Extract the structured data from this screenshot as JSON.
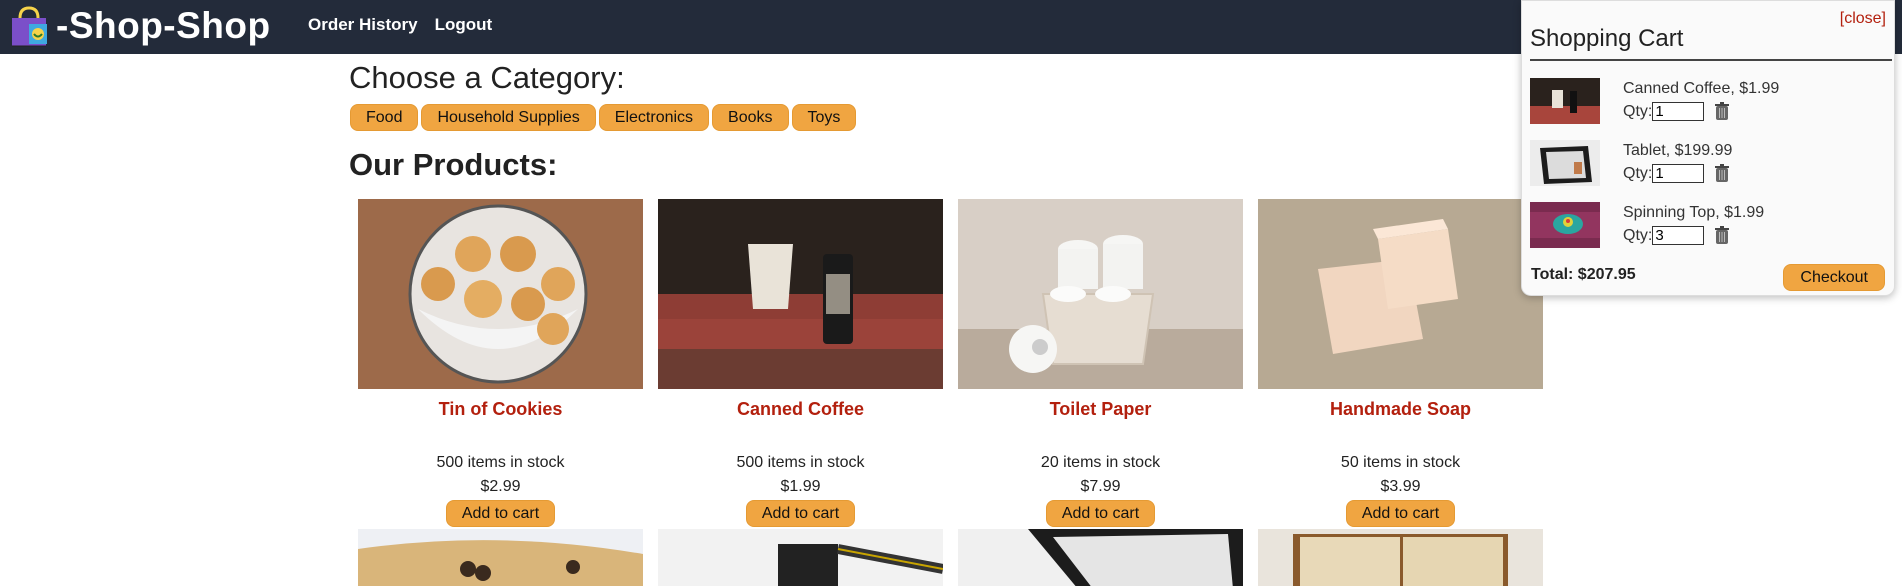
{
  "header": {
    "brand": "-Shop-Shop",
    "nav": [
      "Order History",
      "Logout"
    ]
  },
  "categories": {
    "title": "Choose a Category:",
    "items": [
      "Food",
      "Household Supplies",
      "Electronics",
      "Books",
      "Toys"
    ]
  },
  "products": {
    "title": "Our Products:",
    "items": [
      {
        "name": "Tin of Cookies",
        "stock": "500 items in stock",
        "price": "$2.99",
        "button": "Add to cart"
      },
      {
        "name": "Canned Coffee",
        "stock": "500 items in stock",
        "price": "$1.99",
        "button": "Add to cart"
      },
      {
        "name": "Toilet Paper",
        "stock": "20 items in stock",
        "price": "$7.99",
        "button": "Add to cart"
      },
      {
        "name": "Handmade Soap",
        "stock": "50 items in stock",
        "price": "$3.99",
        "button": "Add to cart"
      }
    ]
  },
  "cart": {
    "close": "[close]",
    "title": "Shopping Cart",
    "items": [
      {
        "label": "Canned Coffee, $1.99",
        "qty_label": "Qty:",
        "qty": "1"
      },
      {
        "label": "Tablet, $199.99",
        "qty_label": "Qty:",
        "qty": "1"
      },
      {
        "label": "Spinning Top, $1.99",
        "qty_label": "Qty:",
        "qty": "3"
      }
    ],
    "total": "Total: $207.95",
    "checkout": "Checkout"
  },
  "colors": {
    "header_bg": "#232b3a",
    "accent_button": "#f0a541",
    "product_name": "#b3200e"
  }
}
